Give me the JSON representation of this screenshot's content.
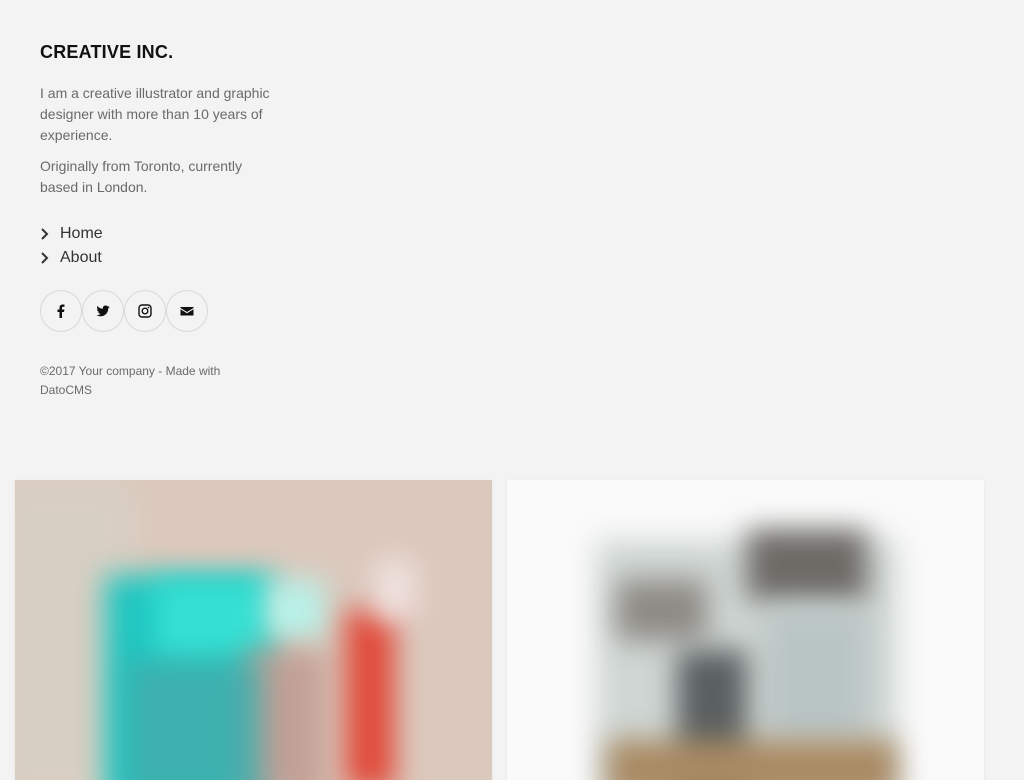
{
  "site": {
    "title": "CREATIVE INC."
  },
  "intro": {
    "paragraph1": "I am a creative illustrator and graphic designer with more than 10 years of experience.",
    "paragraph2": "Originally from Toronto, currently based in London."
  },
  "nav": {
    "items": [
      {
        "label": "Home",
        "icon": "chevron-right-icon"
      },
      {
        "label": "About",
        "icon": "chevron-right-icon"
      }
    ]
  },
  "social": {
    "items": [
      {
        "name": "facebook",
        "icon": "facebook-icon"
      },
      {
        "name": "twitter",
        "icon": "twitter-icon"
      },
      {
        "name": "instagram",
        "icon": "instagram-icon"
      },
      {
        "name": "email",
        "icon": "envelope-icon"
      }
    ]
  },
  "footer": {
    "copyright": "©2017 Your company - Made with DatoCMS"
  },
  "colors": {
    "background": "#f3f3f3",
    "title": "#111111",
    "body_text": "#6a6a6a",
    "border": "#d8d8d8"
  }
}
